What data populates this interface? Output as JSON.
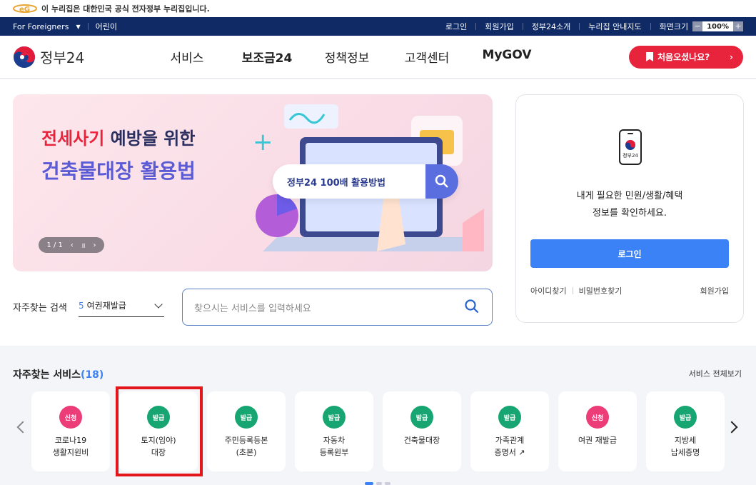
{
  "gov_notice": {
    "text": "이 누리집은 대한민국 공식 전자정부 누리집입니다."
  },
  "util_bar": {
    "foreigners": "For Foreigners",
    "kids": "어린이",
    "links": [
      "로그인",
      "회원가입",
      "정부24소개",
      "누리집 안내지도"
    ],
    "zoom_label": "화면크기",
    "zoom_value": "100%"
  },
  "header": {
    "logo_text": "정부24",
    "nav": [
      {
        "label": "서비스"
      },
      {
        "label": "보조금24"
      },
      {
        "label": "정책정보"
      },
      {
        "label": "고객센터"
      },
      {
        "label": "MyGOV"
      }
    ],
    "cta": "처음오셨나요?"
  },
  "banner": {
    "title_red": "전세사기",
    "title_rest": " 예방을 위한",
    "title2": "건축물대장 활용법",
    "search_text": "정부24 100배 활용방법",
    "pager": "1 / 1"
  },
  "login_card": {
    "phone_label": "정부24",
    "msg_line1": "내게 필요한 민원/생활/혜택",
    "msg_line2": "정보를 확인하세요.",
    "login_button": "로그인",
    "find_id": "아이디찾기",
    "find_pw": "비밀번호찾기",
    "signup": "회원가입"
  },
  "search": {
    "label": "자주찾는 검색",
    "select_num": "5",
    "select_value": "여권재발급",
    "placeholder": "찾으시는 서비스를 입력하세요"
  },
  "services": {
    "title": "자주찾는 서비스",
    "count": "(18)",
    "all_link": "서비스 전체보기",
    "items": [
      {
        "badge": "신청",
        "color": "#ec3d79",
        "name": "코로나19\n생활지원비"
      },
      {
        "badge": "발급",
        "color": "#17a672",
        "name": "토지(임야)\n대장"
      },
      {
        "badge": "발급",
        "color": "#17a672",
        "name": "주민등록등본\n(초본)"
      },
      {
        "badge": "발급",
        "color": "#17a672",
        "name": "자동차\n등록원부"
      },
      {
        "badge": "발급",
        "color": "#17a672",
        "name": "건축물대장"
      },
      {
        "badge": "발급",
        "color": "#17a672",
        "name": "가족관계\n증명서 ↗"
      },
      {
        "badge": "신청",
        "color": "#ec3d79",
        "name": "여권 재발급"
      },
      {
        "badge": "발급",
        "color": "#17a672",
        "name": "지방세\n납세증명"
      }
    ]
  }
}
